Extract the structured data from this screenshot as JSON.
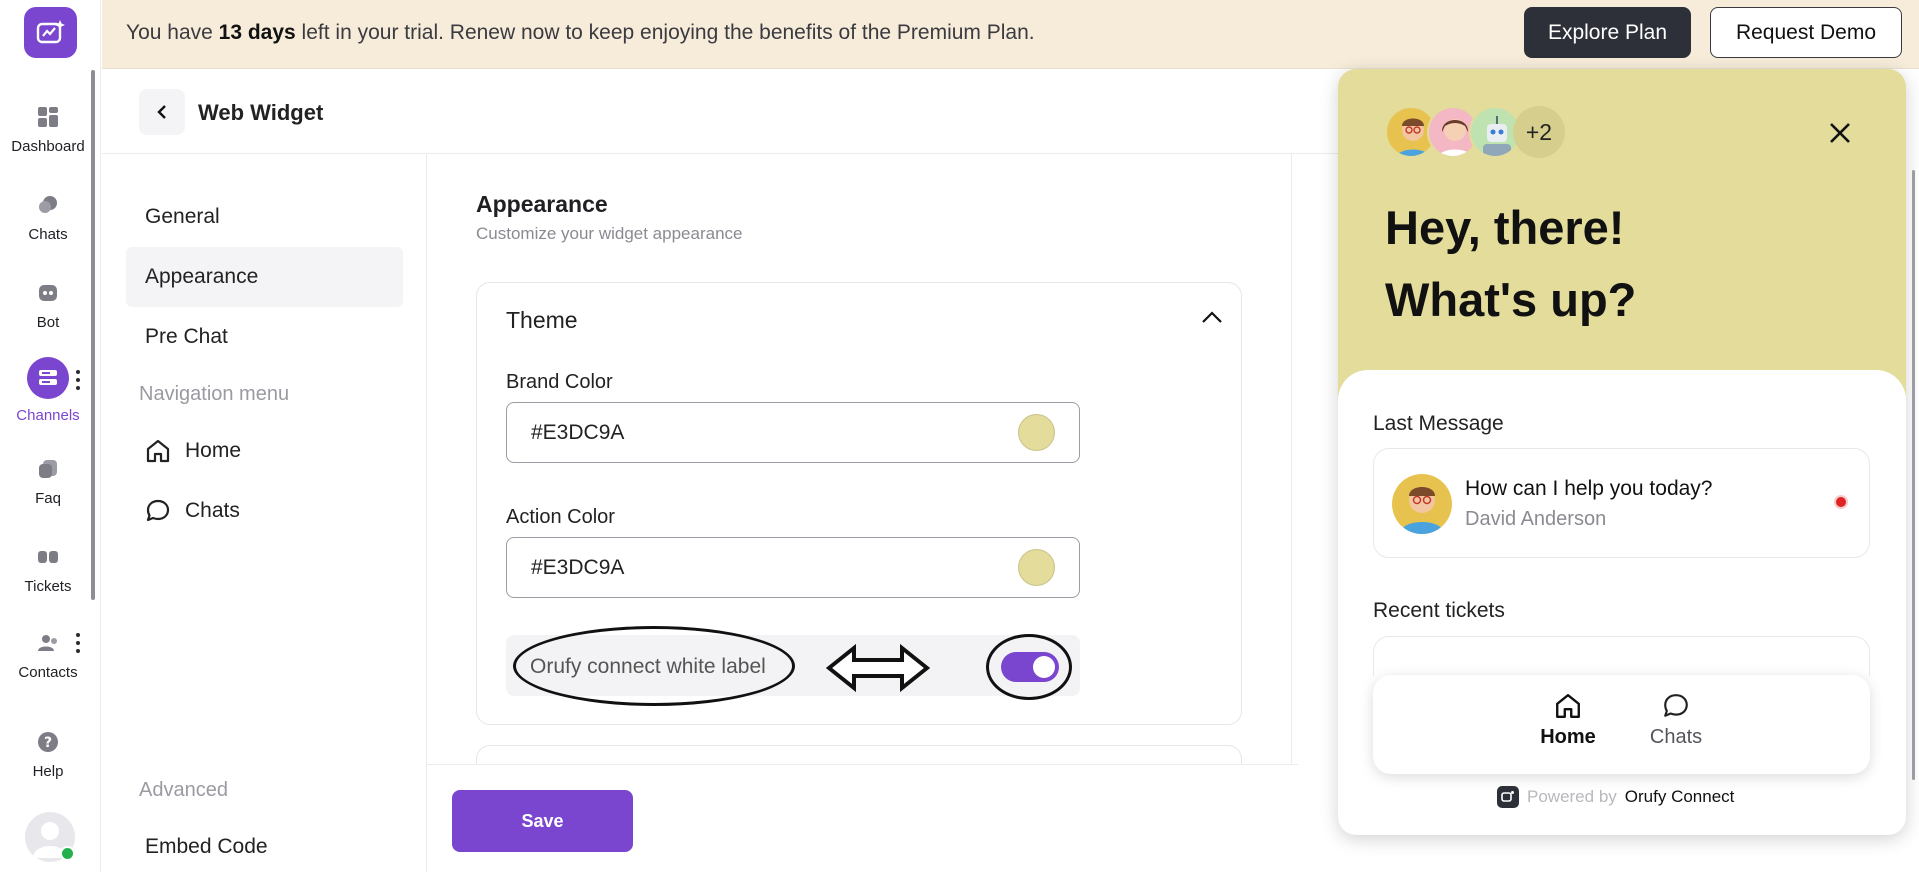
{
  "banner": {
    "text_before": "You have ",
    "text_bold": "13 days",
    "text_after": " left in your trial. Renew now to keep enjoying the benefits of the Premium Plan.",
    "explore_label": "Explore Plan",
    "demo_label": "Request Demo"
  },
  "rail": {
    "items": [
      {
        "label": "Dashboard",
        "icon": "dashboard-icon"
      },
      {
        "label": "Chats",
        "icon": "chats-icon"
      },
      {
        "label": "Bot",
        "icon": "bot-icon"
      },
      {
        "label": "Channels",
        "icon": "channels-icon",
        "active": true
      },
      {
        "label": "Faq",
        "icon": "faq-icon"
      },
      {
        "label": "Tickets",
        "icon": "tickets-icon"
      },
      {
        "label": "Contacts",
        "icon": "contacts-icon"
      },
      {
        "label": "Help",
        "icon": "help-icon"
      }
    ],
    "user_status": "online"
  },
  "header": {
    "title": "Web Widget"
  },
  "subnav": {
    "general": "General",
    "appearance": "Appearance",
    "pre_chat": "Pre Chat",
    "nav_menu_heading": "Navigation menu",
    "home": "Home",
    "chats": "Chats",
    "advanced_heading": "Advanced",
    "embed_code": "Embed Code"
  },
  "main": {
    "title": "Appearance",
    "subtitle": "Customize your widget appearance",
    "theme": {
      "title": "Theme",
      "brand_label": "Brand Color",
      "brand_value": "#E3DC9A",
      "action_label": "Action Color",
      "action_value": "#E3DC9A",
      "white_label": "Orufy connect white label",
      "white_label_enabled": true
    },
    "save_label": "Save"
  },
  "colors": {
    "accent": "#7B46CF",
    "brand": "#E3DC9A",
    "banner_bg": "#F6ECD9",
    "dark_button": "#2D3038"
  },
  "widget": {
    "more_agents": "+2",
    "greeting_1": "Hey, there!",
    "greeting_2": "What's up?",
    "last_message_label": "Last Message",
    "message_title": "How can I help you today?",
    "message_author": "David Anderson",
    "recent_tickets_label": "Recent tickets",
    "nav_home": "Home",
    "nav_chats": "Chats",
    "powered_by": "Powered by",
    "powered_brand": "Orufy Connect"
  }
}
